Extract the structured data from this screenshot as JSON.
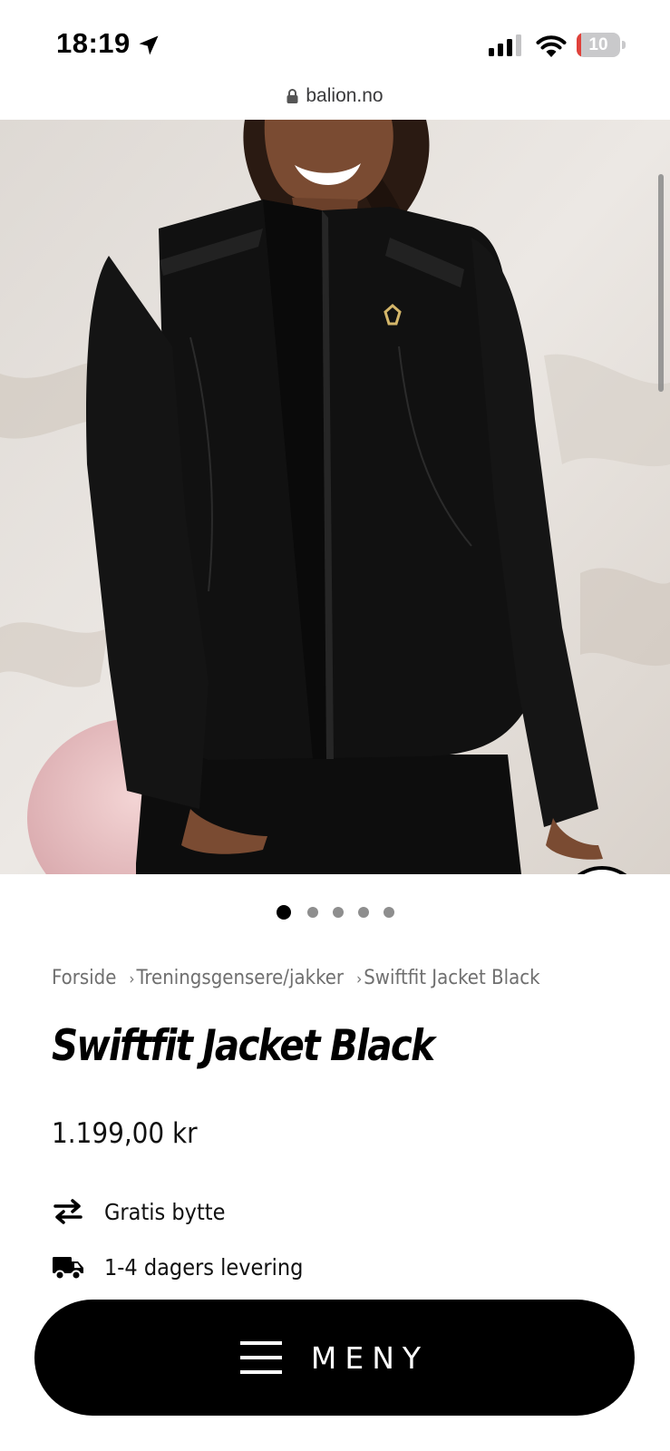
{
  "status_bar": {
    "time": "18:19",
    "battery_level": "10",
    "location_icon": "location-arrow-icon",
    "signal_icon": "cellular-signal-icon",
    "wifi_icon": "wifi-icon",
    "battery_color": "#e0413a"
  },
  "browser": {
    "url": "balion.no",
    "lock_icon": "lock-icon"
  },
  "gallery": {
    "image_alt": "",
    "total_images": 5,
    "active_index": 0,
    "zoom_icon": "search-icon"
  },
  "breadcrumb": {
    "items": [
      "Forside",
      "Treningsgensere/jakker",
      "Swiftfit Jacket Black"
    ],
    "separator": "›"
  },
  "product": {
    "title": "Swiftfit Jacket Black",
    "price": "1.199,00 kr"
  },
  "benefits": [
    {
      "icon": "exchange-arrows-icon",
      "label": "Gratis bytte"
    },
    {
      "icon": "delivery-truck-icon",
      "label": "1-4 dagers levering"
    }
  ],
  "menu": {
    "label": "MENY",
    "icon": "hamburger-icon"
  }
}
